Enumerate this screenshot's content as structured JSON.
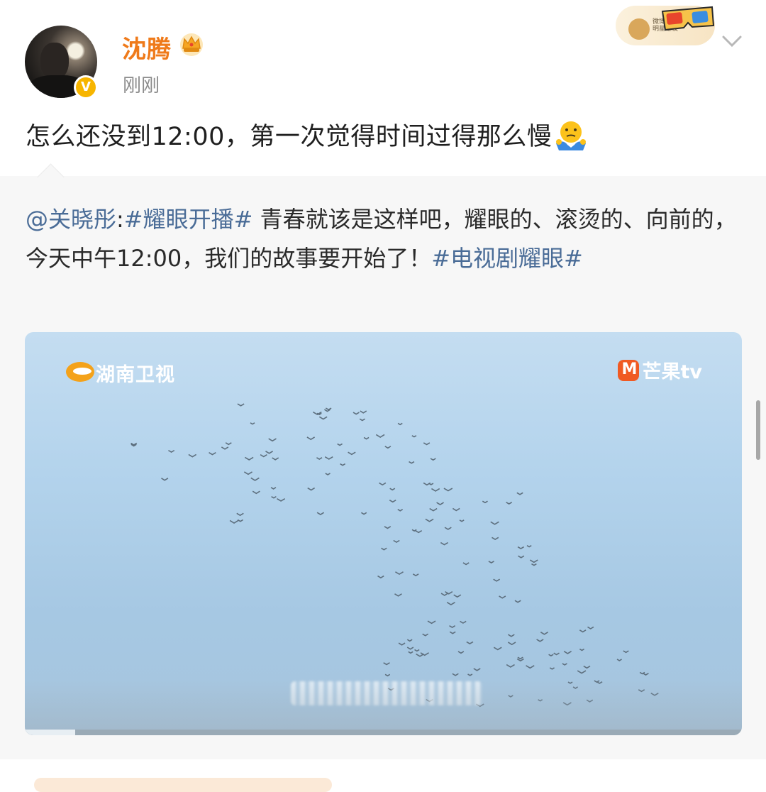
{
  "user": {
    "name": "沈腾",
    "time": "刚刚",
    "verified_mark": "V"
  },
  "decoration": {
    "text": "微博 营销 明星之夜"
  },
  "post": {
    "text": "怎么还没到12:00，第一次觉得时间过得那么慢"
  },
  "repost": {
    "mention": "@关晓彤",
    "separator": ":",
    "topic1": "#耀眼开播#",
    "body": " 青春就该是这样吧，耀眼的、滚烫的、向前的，今天中午12:00，我们的故事要开始了！",
    "topic2": "#电视剧耀眼#"
  },
  "video": {
    "logo_left": "湖南卫视",
    "logo_right": "芒果tv",
    "progress": 0.07
  },
  "icons": {
    "crown": "crown-icon",
    "emoji": "thinking-emoji",
    "menu": "chevron-down-icon",
    "glasses": "3d-glasses-icon"
  },
  "colors": {
    "username": "#ef7a1a",
    "link": "#4a6c97",
    "verified": "#f7b500"
  }
}
